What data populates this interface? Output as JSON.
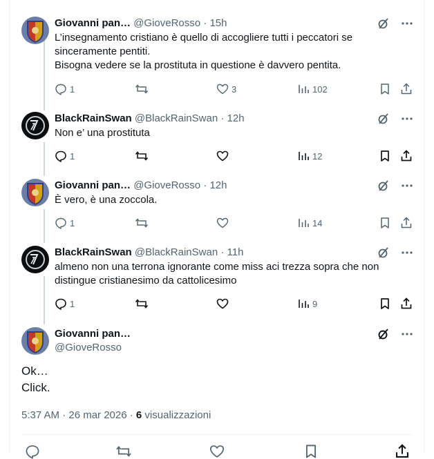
{
  "replies": [
    {
      "name": "Giovanni pan…",
      "handle": "@GioveRosso",
      "time": "15h",
      "lines": [
        "L’insegnamento cristiano è quello di accogliere tutti i peccatori se",
        "sinceramente pentiti.",
        "Bisogna vedere se la prostituta in questione è davvero pentita."
      ],
      "replies": "1",
      "retweets": "",
      "likes": "3",
      "views": "102"
    },
    {
      "name": "BlackRainSwan",
      "handle": "@BlackRainSwan",
      "time": "12h",
      "lines": [
        "Non e’ una prostituta"
      ],
      "replies": "1",
      "retweets": "",
      "likes": "",
      "views": "12"
    },
    {
      "name": "Giovanni pan…",
      "handle": "@GioveRosso",
      "time": "12h",
      "lines": [
        "È vero, è una zoccola."
      ],
      "replies": "1",
      "retweets": "",
      "likes": "",
      "views": "14"
    },
    {
      "name": "BlackRainSwan",
      "handle": "@BlackRainSwan",
      "time": "11h",
      "lines": [
        "almeno non una terrona ignorante come miss aci trezza sopra che non",
        "distingue cristianesimo da cattolicesimo"
      ],
      "replies": "1",
      "retweets": "",
      "likes": "",
      "views": "9"
    }
  ],
  "focused": {
    "name": "Giovanni pan…",
    "handle": "@GioveRosso",
    "lines": [
      "Ok…",
      "Click."
    ],
    "timestamp": "5:37 AM · 26 mar 2026 · ",
    "views_count": "6",
    "views_label": " visualizzazioni"
  },
  "separator": " · ",
  "colors": {
    "text": "#0f1419",
    "secondary": "#536471",
    "border": "#eff3f4",
    "thread": "#cfd9de"
  }
}
